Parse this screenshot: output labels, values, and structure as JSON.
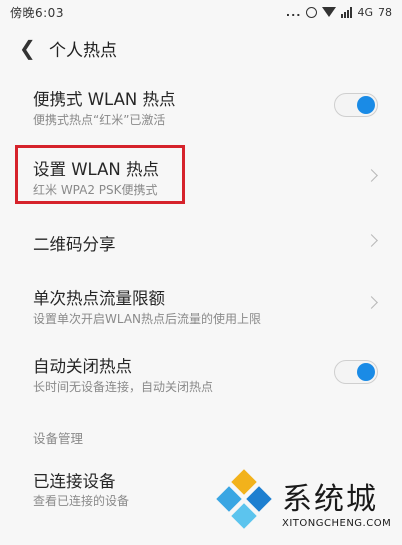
{
  "status_bar": {
    "time": "傍晚6:03",
    "dots": "...",
    "network": "4G",
    "battery": "78"
  },
  "header": {
    "back_icon": "chevron-left-icon",
    "title": "个人热点"
  },
  "rows": [
    {
      "title": "便携式 WLAN 热点",
      "subtitle": "便携式热点“红米”已激活",
      "control": "toggle",
      "on": true
    },
    {
      "title": "设置 WLAN 热点",
      "subtitle": "红米 WPA2 PSK便携式",
      "control": "chevron",
      "highlighted": true
    },
    {
      "title": "二维码分享",
      "subtitle": "",
      "control": "chevron"
    },
    {
      "title": "单次热点流量限额",
      "subtitle": "设置单次开启WLAN热点后流量的使用上限",
      "control": "chevron"
    },
    {
      "title": "自动关闭热点",
      "subtitle": "长时间无设备连接，自动关闭热点",
      "control": "toggle",
      "on": true
    }
  ],
  "section_header": "设备管理",
  "connected": {
    "title": "已连接设备",
    "subtitle": "查看已连接的设备"
  },
  "watermark": {
    "cn": "系统城",
    "en": "XITONGCHENG.COM"
  },
  "colors": {
    "accent": "#1a8be6",
    "highlight": "#d6232b",
    "background": "#f7f7f7"
  }
}
